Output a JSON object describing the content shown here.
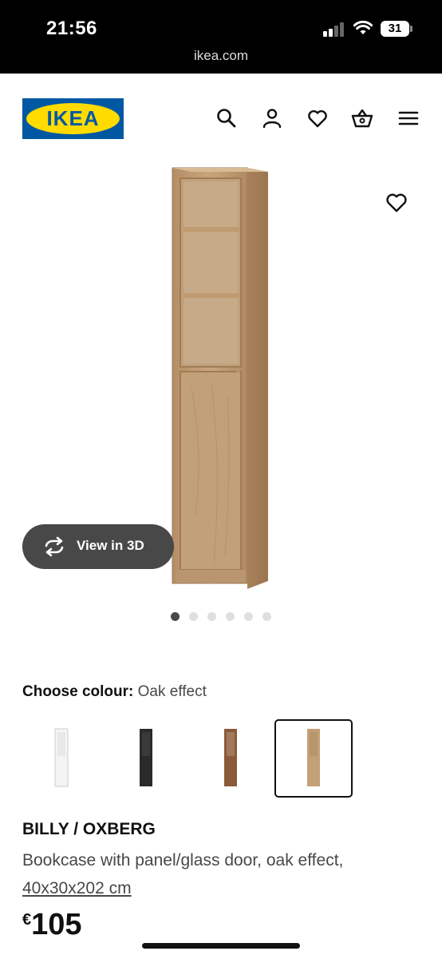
{
  "status_bar": {
    "time": "21:56",
    "battery": "31",
    "url": "ikea.com"
  },
  "header": {
    "logo_text": "IKEA",
    "icons": [
      "search-icon",
      "account-icon",
      "wishlist-icon",
      "basket-icon",
      "menu-icon"
    ]
  },
  "gallery": {
    "view_3d_label": "View in 3D",
    "slide_count": 6,
    "active_slide": 1
  },
  "colour": {
    "label": "Choose colour:",
    "selected": "Oak effect",
    "options": [
      {
        "name": "White",
        "hex": "#f2f2f2"
      },
      {
        "name": "Black-brown",
        "hex": "#2a2a2a"
      },
      {
        "name": "Brown walnut effect",
        "hex": "#8a5a3a"
      },
      {
        "name": "Oak effect",
        "hex": "#c4a078",
        "selected": true
      }
    ]
  },
  "product": {
    "name": "BILLY / OXBERG",
    "description": "Bookcase with panel/glass door, oak effect,",
    "dimensions": "40x30x202 cm",
    "currency": "€",
    "price": "105"
  },
  "colors": {
    "ikea_blue": "#0058a3",
    "ikea_yellow": "#ffdb00",
    "dark_button": "#484848"
  }
}
